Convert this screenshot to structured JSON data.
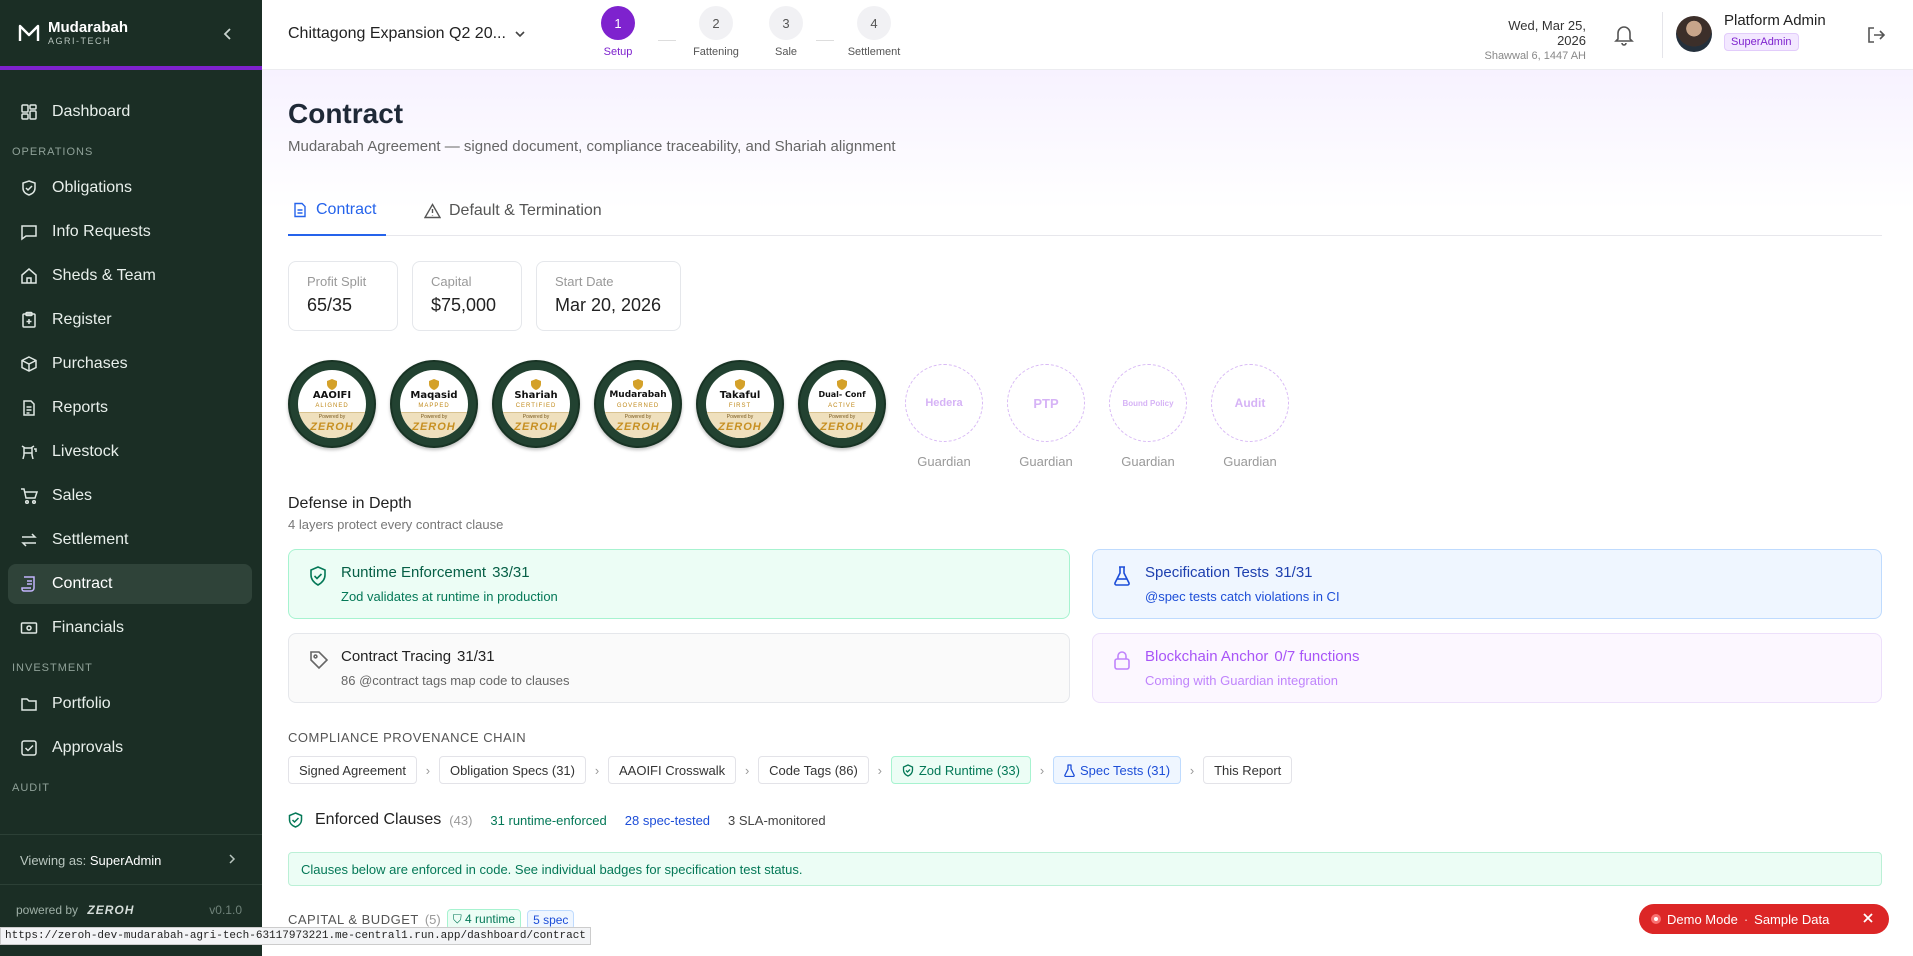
{
  "brand": {
    "name": "Mudarabah",
    "sub": "AGRI-TECH"
  },
  "nav": {
    "dashboard": "Dashboard",
    "section_operations": "OPERATIONS",
    "obligations": "Obligations",
    "info_requests": "Info Requests",
    "sheds": "Sheds & Team",
    "register": "Register",
    "purchases": "Purchases",
    "reports": "Reports",
    "livestock": "Livestock",
    "sales": "Sales",
    "settlement": "Settlement",
    "contract": "Contract",
    "financials": "Financials",
    "section_investment": "INVESTMENT",
    "portfolio": "Portfolio",
    "approvals": "Approvals",
    "section_audit": "AUDIT"
  },
  "sidebar_footer": {
    "viewing_label": "Viewing as:",
    "viewing_role": "SuperAdmin",
    "powered": "powered by",
    "powered_brand": "ZEROH",
    "version": "v0.1.0"
  },
  "topbar": {
    "project": "Chittagong Expansion Q2 20...",
    "steps": [
      {
        "n": "1",
        "label": "Setup"
      },
      {
        "n": "2",
        "label": "Fattening"
      },
      {
        "n": "3",
        "label": "Sale"
      },
      {
        "n": "4",
        "label": "Settlement"
      }
    ],
    "date": "Wed, Mar 25, 2026",
    "hijri": "Shawwal 6, 1447 AH",
    "user": "Platform Admin",
    "role": "SuperAdmin"
  },
  "page": {
    "title": "Contract",
    "subtitle": "Mudarabah Agreement — signed document, compliance traceability, and Shariah alignment"
  },
  "tabs": {
    "contract": "Contract",
    "default": "Default & Termination"
  },
  "stats": [
    {
      "label": "Profit Split",
      "value": "65/35"
    },
    {
      "label": "Capital",
      "value": "$75,000"
    },
    {
      "label": "Start Date",
      "value": "Mar 20, 2026"
    }
  ],
  "badges": [
    {
      "title": "AAOIFI",
      "status": "ALIGNED"
    },
    {
      "title": "Maqasid",
      "status": "MAPPED"
    },
    {
      "title": "Shariah",
      "status": "CERTIFIED"
    },
    {
      "title": "Mudarabah",
      "status": "GOVERNED"
    },
    {
      "title": "Takaful",
      "status": "FIRST"
    },
    {
      "title": "Dual- Conf",
      "status": "ACTIVE"
    }
  ],
  "badge_powered": "Powered by",
  "badge_brand": "ZEROH",
  "guardians": [
    {
      "name": "Hedera",
      "label": "Guardian"
    },
    {
      "name": "PTP",
      "label": "Guardian"
    },
    {
      "name": "Bound Policy",
      "label": "Guardian"
    },
    {
      "name": "Audit",
      "label": "Guardian"
    }
  ],
  "defense": {
    "title": "Defense in Depth",
    "subtitle": "4 layers protect every contract clause",
    "layers": [
      {
        "title": "Runtime Enforcement",
        "count": "33/31",
        "desc": "Zod validates at runtime in production"
      },
      {
        "title": "Specification Tests",
        "count": "31/31",
        "desc": "@spec tests catch violations in CI"
      },
      {
        "title": "Contract Tracing",
        "count": "31/31",
        "desc": "86 @contract tags map code to clauses"
      },
      {
        "title": "Blockchain Anchor",
        "count": "0/7 functions",
        "desc": "Coming with Guardian integration"
      }
    ]
  },
  "provenance": {
    "title": "COMPLIANCE PROVENANCE CHAIN",
    "chain": [
      "Signed Agreement",
      "Obligation Specs (31)",
      "AAOIFI Crosswalk",
      "Code Tags (86)",
      "Zod Runtime (33)",
      "Spec Tests (31)",
      "This Report"
    ]
  },
  "clauses": {
    "title": "Enforced Clauses",
    "count": "(43)",
    "runtime": "31 runtime-enforced",
    "spec": "28 spec-tested",
    "sla": "3 SLA-monitored",
    "note": "Clauses below are enforced in code. See individual badges for specification test status."
  },
  "capital": {
    "title": "CAPITAL & BUDGET",
    "count": "(5)",
    "runtime": "4 runtime",
    "spec": "5 spec"
  },
  "demo": {
    "label": "Demo Mode",
    "sep": "·",
    "sub": "Sample Data"
  },
  "status_url": "https://zeroh-dev-mudarabah-agri-tech-63117973221.me-central1.run.app/dashboard/contract",
  "colors": {
    "sidebar": "#1b2e25",
    "accent": "#7e22ce",
    "link": "#2563eb",
    "success": "#047857",
    "danger": "#dc2626"
  }
}
